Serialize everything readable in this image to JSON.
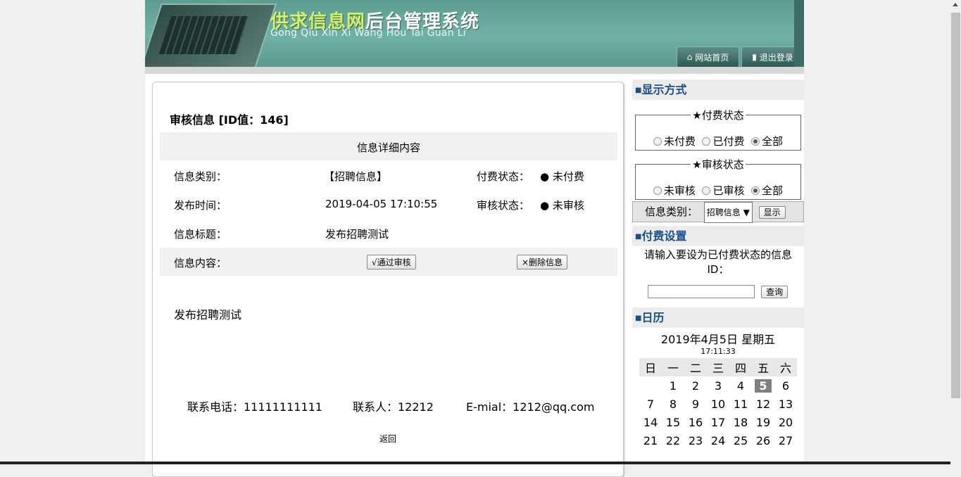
{
  "header": {
    "title_part1": "供求信息网",
    "title_part2": "后台管理系统",
    "title_pinyin": "Gong Qiu Xin Xi Wang Hou Tai Guan Li",
    "nav_home": "网站首页",
    "nav_logout": "退出登录"
  },
  "detail": {
    "heading": "审核信息 [ID值：146]",
    "section_title": "信息详细内容",
    "category_label": "信息类别：",
    "category_value": "【招聘信息】",
    "pay_status_label": "付费状态：",
    "pay_status_value": "● 未付费",
    "publish_time_label": "发布时间：",
    "publish_time_value": "2019-04-05 17:10:55",
    "audit_status_label": "审核状态：",
    "audit_status_value": "● 未审核",
    "info_title_label": "信息标题：",
    "info_title_value": "发布招聘测试",
    "content_label": "信息内容：",
    "approve_button": "√通过审核",
    "delete_button": "×删除信息",
    "content_body": "发布招聘测试",
    "phone": "联系电话：11111111111",
    "contact": "联系人：12212",
    "email": "E-mial：1212@qq.com",
    "back_link": "返回"
  },
  "sidebar": {
    "display_heading": "显示方式",
    "pay_legend": "★付费状态",
    "pay_options": [
      "未付费",
      "已付费",
      "全部"
    ],
    "pay_selected": "全部",
    "audit_legend": "★审核状态",
    "audit_options": [
      "未审核",
      "已审核",
      "全部"
    ],
    "audit_selected": "全部",
    "category_label": "信息类别：",
    "category_select": "招聘信息",
    "show_button": "显示",
    "pay_setting_heading": "付费设置",
    "pay_setting_prompt": "请输入要设为已付费状态的信息ID：",
    "query_button": "查询",
    "calendar_heading": "日历",
    "calendar_date": "2019年4月5日 星期五",
    "calendar_time": "17:11:33",
    "weekdays": [
      "日",
      "一",
      "二",
      "三",
      "四",
      "五",
      "六"
    ],
    "weeks": [
      [
        "",
        "1",
        "2",
        "3",
        "4",
        "5",
        "6"
      ],
      [
        "7",
        "8",
        "9",
        "10",
        "11",
        "12",
        "13"
      ],
      [
        "14",
        "15",
        "16",
        "17",
        "18",
        "19",
        "20"
      ],
      [
        "21",
        "22",
        "23",
        "24",
        "25",
        "26",
        "27"
      ]
    ],
    "today": "5"
  }
}
